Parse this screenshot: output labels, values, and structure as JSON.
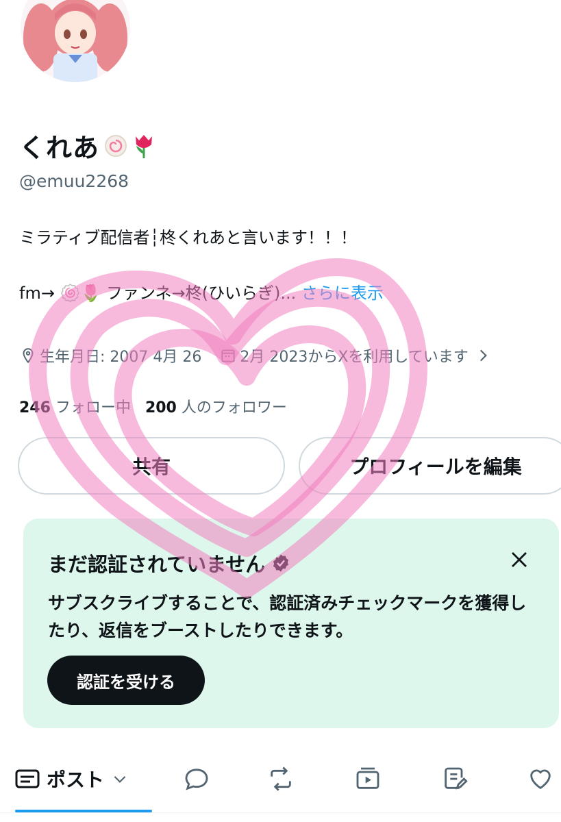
{
  "profile": {
    "display_name": "くれあ",
    "name_emojis": [
      "naruto-emoji",
      "tulip-emoji"
    ],
    "handle": "@emuu2268",
    "bio_line1": "ミラティブ配信者┆柊くれあと言います！！！",
    "bio_line2": "fm→ 🍥🌷 ファンネ→柊(ひいらぎ)...",
    "bio_more": "さらに表示",
    "birthday": "生年月日: 2007 4月 26",
    "joined": "2月 2023からXを利用しています",
    "following_count": "246",
    "following_label": "フォロー中",
    "followers_count": "200",
    "followers_label": "人のフォロワー"
  },
  "actions": {
    "share_label": "共有",
    "edit_label": "プロフィールを編集"
  },
  "verify_card": {
    "title": "まだ認証されていません",
    "description": "サブスクライブすることで、認証済みチェックマークを獲得したり、返信をブーストしたりできます。",
    "button_label": "認証を受ける"
  },
  "tabs": {
    "posts_label": "ポスト",
    "icons": [
      "posts-icon",
      "reply-icon",
      "repost-icon",
      "media-icon",
      "article-icon",
      "like-icon"
    ]
  },
  "colors": {
    "link": "#1d9bf0",
    "verify_bg": "#def7ec",
    "muted": "#536471",
    "heart_overlay": "#f080c0"
  }
}
